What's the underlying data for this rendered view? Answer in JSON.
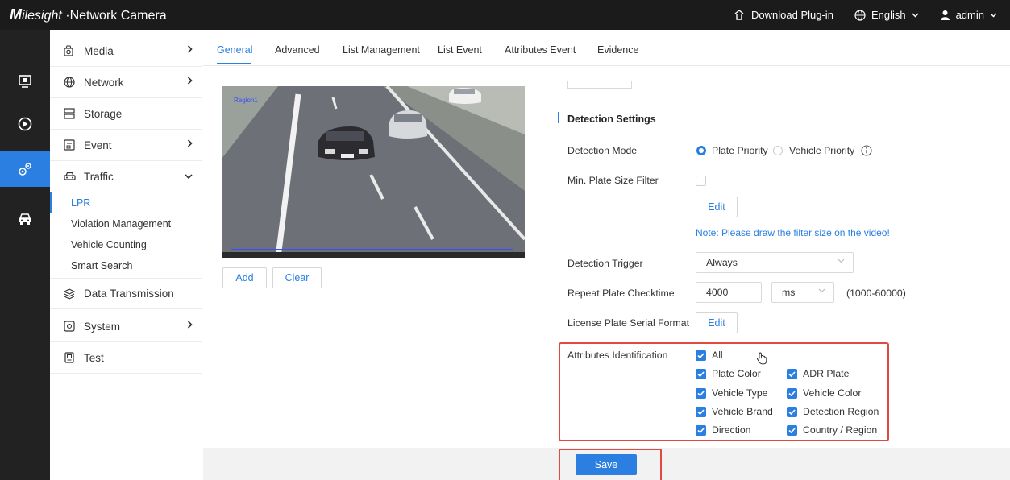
{
  "header": {
    "brand_m": "M",
    "brand_rest": "ilesight",
    "brand_suffix": " ·Network Camera",
    "download": "Download Plug-in",
    "language": "English",
    "user": "admin"
  },
  "rail": {
    "items": [
      {
        "icon": "live-view-icon"
      },
      {
        "icon": "playback-icon"
      },
      {
        "icon": "settings-gears-icon"
      },
      {
        "icon": "car-icon"
      }
    ]
  },
  "nav": {
    "items": [
      {
        "label": "Media",
        "icon": "media-icon",
        "chevron": ">"
      },
      {
        "label": "Network",
        "icon": "globe-icon",
        "chevron": ">"
      },
      {
        "label": "Storage",
        "icon": "storage-icon",
        "chevron": ""
      },
      {
        "label": "Event",
        "icon": "event-icon",
        "chevron": ">"
      },
      {
        "label": "Traffic",
        "icon": "car-icon",
        "chevron": "v"
      },
      {
        "label": "Data Transmission",
        "icon": "layers-icon",
        "chevron": ""
      },
      {
        "label": "System",
        "icon": "system-icon",
        "chevron": ">"
      },
      {
        "label": "Test",
        "icon": "test-icon",
        "chevron": ""
      }
    ],
    "traffic_sub": [
      "LPR",
      "Violation Management",
      "Vehicle Counting",
      "Smart Search"
    ]
  },
  "tabs": [
    "General",
    "Advanced",
    "List Management",
    "List Event",
    "Attributes Event",
    "Evidence"
  ],
  "video": {
    "region_label": "Region1"
  },
  "buttons": {
    "add": "Add",
    "clear": "Clear",
    "edit": "Edit",
    "edit2": "Edit",
    "save": "Save"
  },
  "settings": {
    "section": "Detection Settings",
    "detection_mode_label": "Detection Mode",
    "plate_priority": "Plate Priority",
    "vehicle_priority": "Vehicle Priority",
    "info_icon": "info-icon",
    "min_plate_label": "Min. Plate Size Filter",
    "note": "Note: Please draw the filter size on the video!",
    "trigger_label": "Detection Trigger",
    "trigger_value": "Always",
    "repeat_label": "Repeat Plate Checktime",
    "repeat_value": "4000",
    "repeat_unit": "ms",
    "repeat_range": "(1000-60000)",
    "serial_label": "License Plate Serial Format",
    "attr_label": "Attributes Identification"
  },
  "attributes": {
    "all": "All",
    "left": [
      "Plate Color",
      "Vehicle Type",
      "Vehicle Brand",
      "Direction"
    ],
    "right": [
      "ADR Plate",
      "Vehicle Color",
      "Detection Region",
      "Country / Region"
    ]
  },
  "colors": {
    "accent": "#2a7fe0",
    "highlight": "#e04a3f",
    "topbar": "#1b1b1b",
    "rail": "#222222"
  }
}
